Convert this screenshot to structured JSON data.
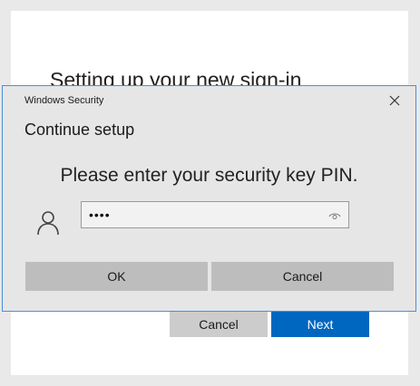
{
  "background_dialog": {
    "heading": "Setting up your new sign-in",
    "cancel_label": "Cancel",
    "next_label": "Next"
  },
  "security_dialog": {
    "window_title": "Windows Security",
    "heading": "Continue setup",
    "prompt": "Please enter your security key PIN.",
    "pin_value": "••••",
    "ok_label": "OK",
    "cancel_label": "Cancel",
    "icons": {
      "close": "close-icon",
      "user": "user-icon",
      "reveal": "eye-icon"
    }
  },
  "colors": {
    "accent": "#0067c0",
    "dialog_border": "#4a90d9",
    "dialog_bg": "#e6e6e6"
  }
}
